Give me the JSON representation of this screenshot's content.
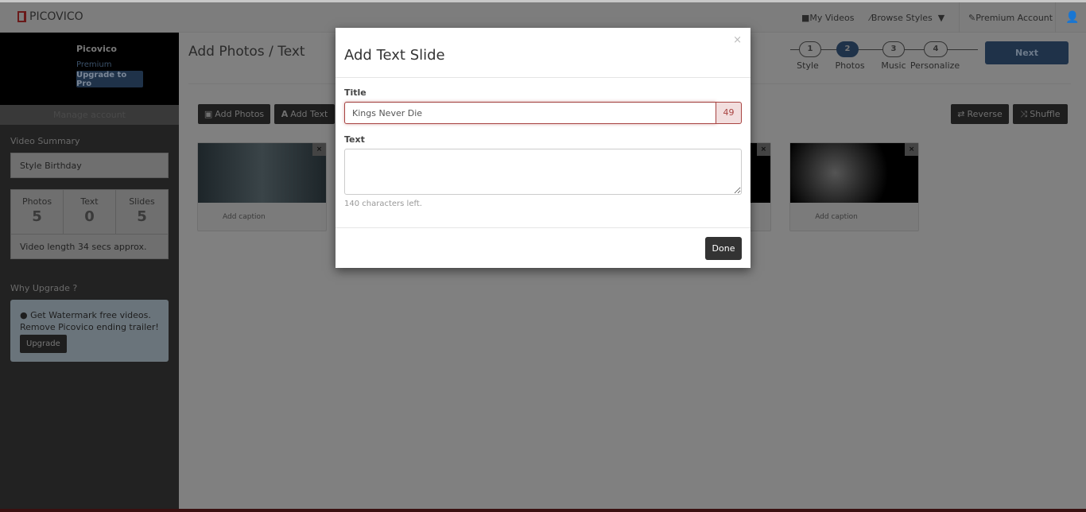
{
  "app": {
    "logo": "PICOVICO"
  },
  "nav": {
    "my_videos": "My Videos",
    "browse_styles": "Browse Styles",
    "premium": "Premium Account"
  },
  "sidebar": {
    "name": "Picovico",
    "plan": "Premium",
    "upgrade_pro": "Upgrade to Pro",
    "manage": "Manage account",
    "summary_title": "Video Summary",
    "style": "Style Birthday",
    "stats": [
      {
        "label": "Photos",
        "value": "5"
      },
      {
        "label": "Text",
        "value": "0"
      },
      {
        "label": "Slides",
        "value": "5"
      }
    ],
    "length": "Video length 34 secs approx.",
    "why_title": "Why Upgrade ?",
    "why_line1": "Get Watermark free videos.",
    "why_line2": "Remove Picovico ending trailer!",
    "why_button": "Upgrade"
  },
  "main": {
    "title": "Add Photos / Text",
    "add_photos": "Add Photos",
    "add_text": "Add Text",
    "reverse": "Reverse",
    "shuffle": "Shuffle",
    "next": "Next",
    "steps": [
      {
        "num": "1",
        "label": "Style"
      },
      {
        "num": "2",
        "label": "Photos"
      },
      {
        "num": "3",
        "label": "Music"
      },
      {
        "num": "4",
        "label": "Personalize"
      }
    ],
    "active_step": 2,
    "caption_placeholder": "Add caption",
    "photo_count": 5
  },
  "modal": {
    "title": "Add Text Slide",
    "close": "×",
    "title_label": "Title",
    "title_value": "Kings Never Die",
    "title_counter": "49",
    "text_label": "Text",
    "text_value": "",
    "chars_left": "140 characters left.",
    "done": "Done"
  },
  "colors": {
    "accent": "#1f3249",
    "error": "#a94442"
  }
}
